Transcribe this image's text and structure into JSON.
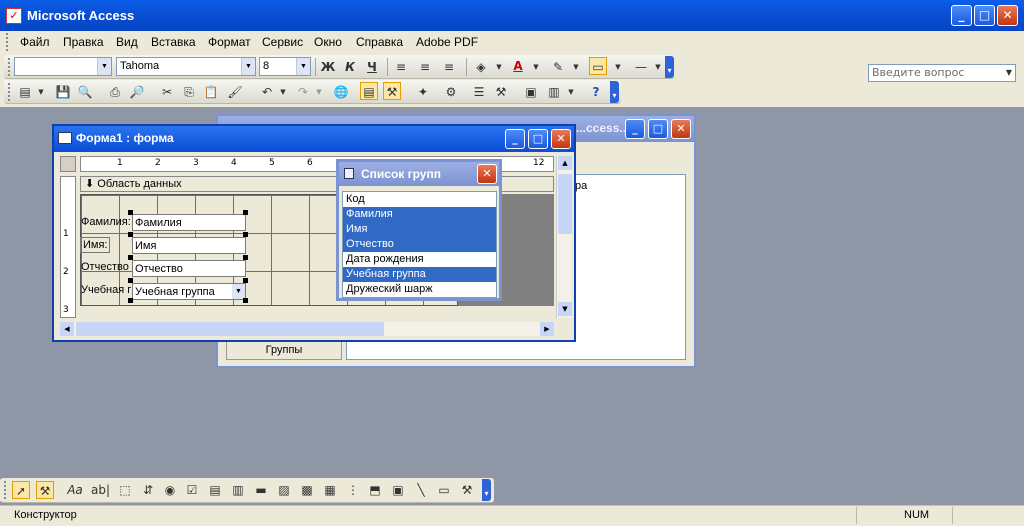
{
  "app": {
    "title": "Microsoft Access",
    "icon_name": "access-key-icon"
  },
  "menu": {
    "items": [
      "Файл",
      "Правка",
      "Вид",
      "Вставка",
      "Формат",
      "Сервис",
      "Окно",
      "Справка",
      "Adobe PDF"
    ],
    "ask_placeholder": "Введите вопрос"
  },
  "format_toolbar": {
    "object_combo": "",
    "font_combo": "Tahoma",
    "size_combo": "8",
    "bold": "Ж",
    "italic": "К",
    "underline": "Ч",
    "font_color_letter": "A"
  },
  "back_window": {
    "title": "...ccess...",
    "text_fragment": "ра",
    "button_label": "Группы"
  },
  "form_window": {
    "title": "Форма1 : форма",
    "section_label": "Область данных",
    "ruler_numbers": [
      "1",
      "2",
      "3",
      "4",
      "5",
      "6",
      "12"
    ],
    "vruler_numbers": [
      "1",
      "2",
      "3"
    ],
    "controls": [
      {
        "label": "Фамилия:",
        "field": "Фамилия"
      },
      {
        "label": "Имя:",
        "field": "Имя"
      },
      {
        "label": "Отчество",
        "field": "Отчество"
      },
      {
        "label": "Учебная гр",
        "field": "Учебная группа"
      }
    ]
  },
  "field_list": {
    "title": "Список групп",
    "items": [
      {
        "label": "Код",
        "selected": false
      },
      {
        "label": "Фамилия",
        "selected": true
      },
      {
        "label": "Имя",
        "selected": true
      },
      {
        "label": "Отчество",
        "selected": true
      },
      {
        "label": "Дата рождения",
        "selected": false
      },
      {
        "label": "Учебная группа",
        "selected": true
      },
      {
        "label": "Дружеский шарж",
        "selected": false
      }
    ]
  },
  "status": {
    "mode": "Конструктор",
    "num": "NUM"
  },
  "colors": {
    "accent": "#316ac5",
    "titlebar": "#0a4dd5",
    "desktop": "#8f97a7"
  }
}
